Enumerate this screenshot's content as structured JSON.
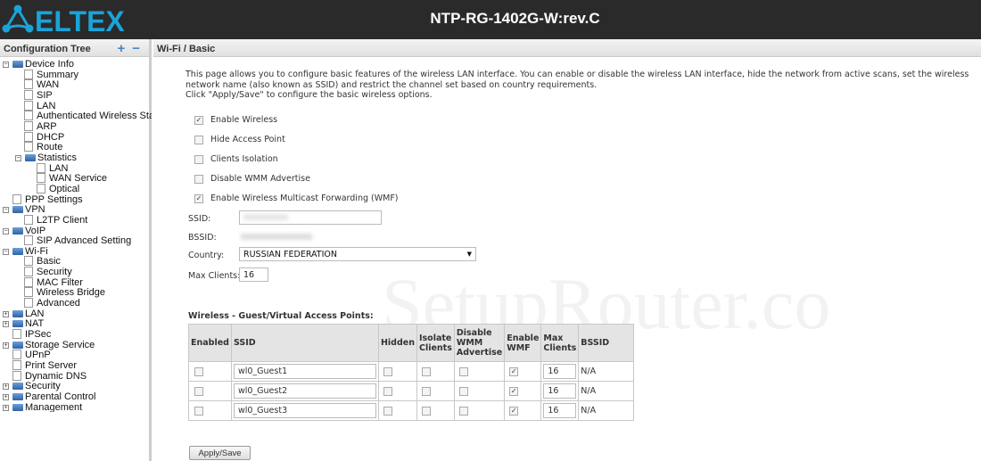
{
  "header": {
    "logo": "ELTEX",
    "title": "NTP-RG-1402G-W:rev.C"
  },
  "sidebar": {
    "title": "Configuration Tree",
    "expand_icon": "plus-icon",
    "collapse_icon": "minus-icon",
    "items": [
      {
        "label": "Device Info",
        "level": 0,
        "type": "folder",
        "state": "expanded"
      },
      {
        "label": "Summary",
        "level": 1,
        "type": "page"
      },
      {
        "label": "WAN",
        "level": 1,
        "type": "page"
      },
      {
        "label": "SIP",
        "level": 1,
        "type": "page"
      },
      {
        "label": "LAN",
        "level": 1,
        "type": "page"
      },
      {
        "label": "Authenticated Wireless Station",
        "level": 1,
        "type": "page"
      },
      {
        "label": "ARP",
        "level": 1,
        "type": "page"
      },
      {
        "label": "DHCP",
        "level": 1,
        "type": "page"
      },
      {
        "label": "Route",
        "level": 1,
        "type": "page"
      },
      {
        "label": "Statistics",
        "level": 1,
        "type": "folder",
        "state": "expanded"
      },
      {
        "label": "LAN",
        "level": 2,
        "type": "page"
      },
      {
        "label": "WAN Service",
        "level": 2,
        "type": "page"
      },
      {
        "label": "Optical",
        "level": 2,
        "type": "page"
      },
      {
        "label": "PPP Settings",
        "level": 0,
        "type": "page"
      },
      {
        "label": "VPN",
        "level": 0,
        "type": "folder",
        "state": "expanded"
      },
      {
        "label": "L2TP Client",
        "level": 1,
        "type": "page"
      },
      {
        "label": "VoIP",
        "level": 0,
        "type": "folder",
        "state": "expanded"
      },
      {
        "label": "SIP Advanced Setting",
        "level": 1,
        "type": "page"
      },
      {
        "label": "Wi-Fi",
        "level": 0,
        "type": "folder",
        "state": "expanded"
      },
      {
        "label": "Basic",
        "level": 1,
        "type": "page"
      },
      {
        "label": "Security",
        "level": 1,
        "type": "page"
      },
      {
        "label": "MAC Filter",
        "level": 1,
        "type": "page"
      },
      {
        "label": "Wireless Bridge",
        "level": 1,
        "type": "page"
      },
      {
        "label": "Advanced",
        "level": 1,
        "type": "page"
      },
      {
        "label": "LAN",
        "level": 0,
        "type": "folder",
        "state": "collapsed"
      },
      {
        "label": "NAT",
        "level": 0,
        "type": "folder",
        "state": "collapsed"
      },
      {
        "label": "IPSec",
        "level": 0,
        "type": "page"
      },
      {
        "label": "Storage Service",
        "level": 0,
        "type": "folder",
        "state": "collapsed"
      },
      {
        "label": "UPnP",
        "level": 0,
        "type": "page"
      },
      {
        "label": "Print Server",
        "level": 0,
        "type": "page"
      },
      {
        "label": "Dynamic DNS",
        "level": 0,
        "type": "page"
      },
      {
        "label": "Security",
        "level": 0,
        "type": "folder",
        "state": "collapsed"
      },
      {
        "label": "Parental Control",
        "level": 0,
        "type": "folder",
        "state": "collapsed"
      },
      {
        "label": "Management",
        "level": 0,
        "type": "folder",
        "state": "collapsed"
      }
    ]
  },
  "main": {
    "breadcrumb": "Wi-Fi / Basic",
    "intro1": "This page allows you to configure basic features of the wireless LAN interface. You can enable or disable the wireless LAN interface, hide the network from active scans, set the wireless network name (also known as SSID) and restrict the channel set based on country requirements.",
    "intro2": "Click \"Apply/Save\" to configure the basic wireless options.",
    "options": [
      {
        "label": "Enable Wireless",
        "checked": true
      },
      {
        "label": "Hide Access Point",
        "checked": false
      },
      {
        "label": "Clients Isolation",
        "checked": false
      },
      {
        "label": "Disable WMM Advertise",
        "checked": false
      },
      {
        "label": "Enable Wireless Multicast Forwarding (WMF)",
        "checked": true
      }
    ],
    "ssid_label": "SSID:",
    "bssid_label": "BSSID:",
    "country_label": "Country:",
    "country_value": "RUSSIAN FEDERATION",
    "max_clients_label": "Max Clients:",
    "max_clients_value": "16",
    "guest_title": "Wireless - Guest/Virtual Access Points:",
    "columns": [
      "Enabled",
      "SSID",
      "Hidden",
      "Isolate Clients",
      "Disable WMM Advertise",
      "Enable WMF",
      "Max Clients",
      "BSSID"
    ],
    "rows": [
      {
        "enabled": false,
        "ssid": "wl0_Guest1",
        "hidden": false,
        "isolate": false,
        "disable_wmm": false,
        "wmf": true,
        "max": "16",
        "bssid": "N/A"
      },
      {
        "enabled": false,
        "ssid": "wl0_Guest2",
        "hidden": false,
        "isolate": false,
        "disable_wmm": false,
        "wmf": true,
        "max": "16",
        "bssid": "N/A"
      },
      {
        "enabled": false,
        "ssid": "wl0_Guest3",
        "hidden": false,
        "isolate": false,
        "disable_wmm": false,
        "wmf": true,
        "max": "16",
        "bssid": "N/A"
      }
    ],
    "apply_label": "Apply/Save",
    "watermark": "SetupRouter.co"
  },
  "colors": {
    "header_bg": "#2a2a2a",
    "logo": "#1aa3d9",
    "folder": "#2f62a5"
  }
}
